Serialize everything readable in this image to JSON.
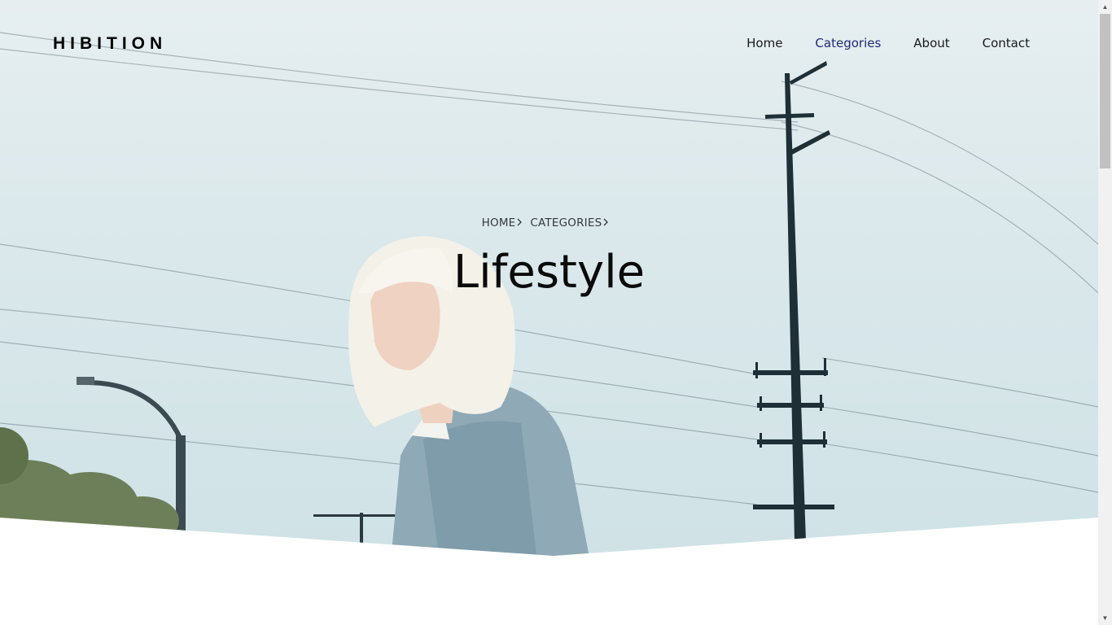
{
  "header": {
    "logo": "HIBITION",
    "nav": [
      {
        "label": "Home",
        "active": false
      },
      {
        "label": "Categories",
        "active": true
      },
      {
        "label": "About",
        "active": false
      },
      {
        "label": "Contact",
        "active": false
      }
    ]
  },
  "hero": {
    "breadcrumb": [
      {
        "label": "HOME"
      },
      {
        "label": "CATEGORIES"
      }
    ],
    "title": "Lifestyle",
    "image_subject": "woman with platinum bob in denim jacket under utility poles and power lines"
  },
  "colors": {
    "active_nav": "#1f2a78",
    "text": "#1a1a1a",
    "sky": "#dae8eb"
  },
  "icons": {
    "breadcrumb_separator": "chevron-right-icon",
    "scroll_up": "arrow-up-icon",
    "scroll_down": "arrow-down-icon"
  }
}
